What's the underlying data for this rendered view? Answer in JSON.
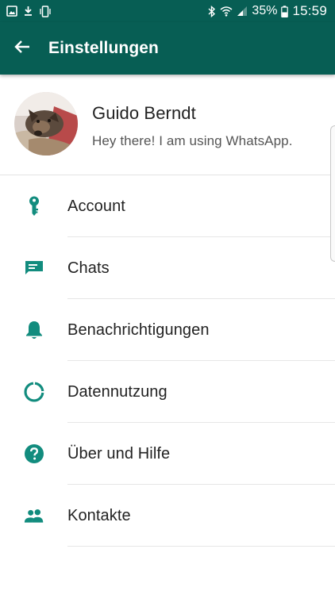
{
  "status_bar": {
    "battery_percent": "35%",
    "time": "15:59",
    "icons": [
      "image-icon",
      "download-icon",
      "vibrate-icon",
      "bluetooth-icon",
      "wifi-icon",
      "signal-icon",
      "battery-icon"
    ]
  },
  "app_bar": {
    "title": "Einstellungen",
    "back_icon": "arrow-back-icon"
  },
  "profile": {
    "name": "Guido Berndt",
    "status": "Hey there! I am using WhatsApp."
  },
  "menu": {
    "items": [
      {
        "label": "Account",
        "icon": "key-icon"
      },
      {
        "label": "Chats",
        "icon": "chat-icon"
      },
      {
        "label": "Benachrichtigungen",
        "icon": "bell-icon"
      },
      {
        "label": "Datennutzung",
        "icon": "data-usage-icon"
      },
      {
        "label": "Über und Hilfe",
        "icon": "help-icon"
      },
      {
        "label": "Kontakte",
        "icon": "contacts-icon"
      }
    ]
  },
  "colors": {
    "primary": "#075e54",
    "accent": "#128c7e",
    "text": "#222222",
    "secondary_text": "#555555"
  }
}
